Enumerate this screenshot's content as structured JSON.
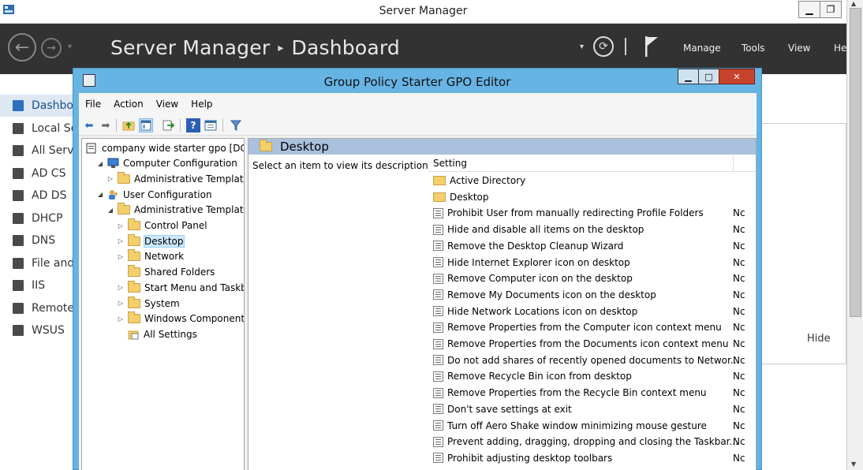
{
  "outer": {
    "title": "Server Manager",
    "breadcrumb_app": "Server Manager",
    "breadcrumb_page": "Dashboard",
    "menu": [
      "Manage",
      "Tools",
      "View",
      "He"
    ],
    "nav": [
      {
        "label": "Dashboard",
        "icon": "dashboard-icon",
        "active": true
      },
      {
        "label": "Local Server",
        "icon": "server-icon"
      },
      {
        "label": "All Servers",
        "icon": "servers-icon"
      },
      {
        "label": "AD CS",
        "icon": "adcs-icon"
      },
      {
        "label": "AD DS",
        "icon": "adds-icon"
      },
      {
        "label": "DHCP",
        "icon": "dhcp-icon"
      },
      {
        "label": "DNS",
        "icon": "dns-icon"
      },
      {
        "label": "File and Storage Services",
        "icon": "file-icon"
      },
      {
        "label": "IIS",
        "icon": "iis-icon"
      },
      {
        "label": "Remote Access",
        "icon": "remote-icon"
      },
      {
        "label": "WSUS",
        "icon": "wsus-icon"
      }
    ],
    "hide_label": "Hide"
  },
  "gpo": {
    "title": "Group Policy Starter GPO Editor",
    "menu": [
      "File",
      "Action",
      "View",
      "Help"
    ],
    "tree": [
      {
        "label": "company wide starter gpo [DC.company.pri]",
        "indent": 0,
        "exp": "",
        "icon": "gpo"
      },
      {
        "label": "Computer Configuration",
        "indent": 1,
        "exp": "◢",
        "icon": "computer"
      },
      {
        "label": "Administrative Templates",
        "indent": 2,
        "exp": "▷",
        "icon": "folder"
      },
      {
        "label": "User Configuration",
        "indent": 1,
        "exp": "◢",
        "icon": "user"
      },
      {
        "label": "Administrative Templates",
        "indent": 2,
        "exp": "◢",
        "icon": "folder"
      },
      {
        "label": "Control Panel",
        "indent": 3,
        "exp": "▷",
        "icon": "folder"
      },
      {
        "label": "Desktop",
        "indent": 3,
        "exp": "▷",
        "icon": "folder",
        "selected": true
      },
      {
        "label": "Network",
        "indent": 3,
        "exp": "▷",
        "icon": "folder"
      },
      {
        "label": "Shared Folders",
        "indent": 3,
        "exp": "",
        "icon": "folder"
      },
      {
        "label": "Start Menu and Taskbar",
        "indent": 3,
        "exp": "▷",
        "icon": "folder"
      },
      {
        "label": "System",
        "indent": 3,
        "exp": "▷",
        "icon": "folder"
      },
      {
        "label": "Windows Components",
        "indent": 3,
        "exp": "▷",
        "icon": "folder"
      },
      {
        "label": "All Settings",
        "indent": 3,
        "exp": "",
        "icon": "allsettings"
      }
    ],
    "pane_title": "Desktop",
    "description": "Select an item to view its description.",
    "col_setting": "Setting",
    "folders": [
      "Active Directory",
      "Desktop"
    ],
    "policies": [
      {
        "name": "Prohibit User from manually redirecting Profile Folders",
        "state": "Nc"
      },
      {
        "name": "Hide and disable all items on the desktop",
        "state": "Nc"
      },
      {
        "name": "Remove the Desktop Cleanup Wizard",
        "state": "Nc"
      },
      {
        "name": "Hide Internet Explorer icon on desktop",
        "state": "Nc"
      },
      {
        "name": "Remove Computer icon on the desktop",
        "state": "Nc"
      },
      {
        "name": "Remove My Documents icon on the desktop",
        "state": "Nc"
      },
      {
        "name": "Hide Network Locations icon on desktop",
        "state": "Nc"
      },
      {
        "name": "Remove Properties from the Computer icon context menu",
        "state": "Nc"
      },
      {
        "name": "Remove Properties from the Documents icon context menu",
        "state": "Nc"
      },
      {
        "name": "Do not add shares of recently opened documents to Networ...",
        "state": "Nc"
      },
      {
        "name": "Remove Recycle Bin icon from desktop",
        "state": "Nc"
      },
      {
        "name": "Remove Properties from the Recycle Bin context menu",
        "state": "Nc"
      },
      {
        "name": "Don't save settings at exit",
        "state": "Nc"
      },
      {
        "name": "Turn off Aero Shake window minimizing mouse gesture",
        "state": "Nc"
      },
      {
        "name": "Prevent adding, dragging, dropping and closing the Taskbar...",
        "state": "Nc"
      },
      {
        "name": "Prohibit adjusting desktop toolbars",
        "state": "Nc"
      }
    ]
  }
}
